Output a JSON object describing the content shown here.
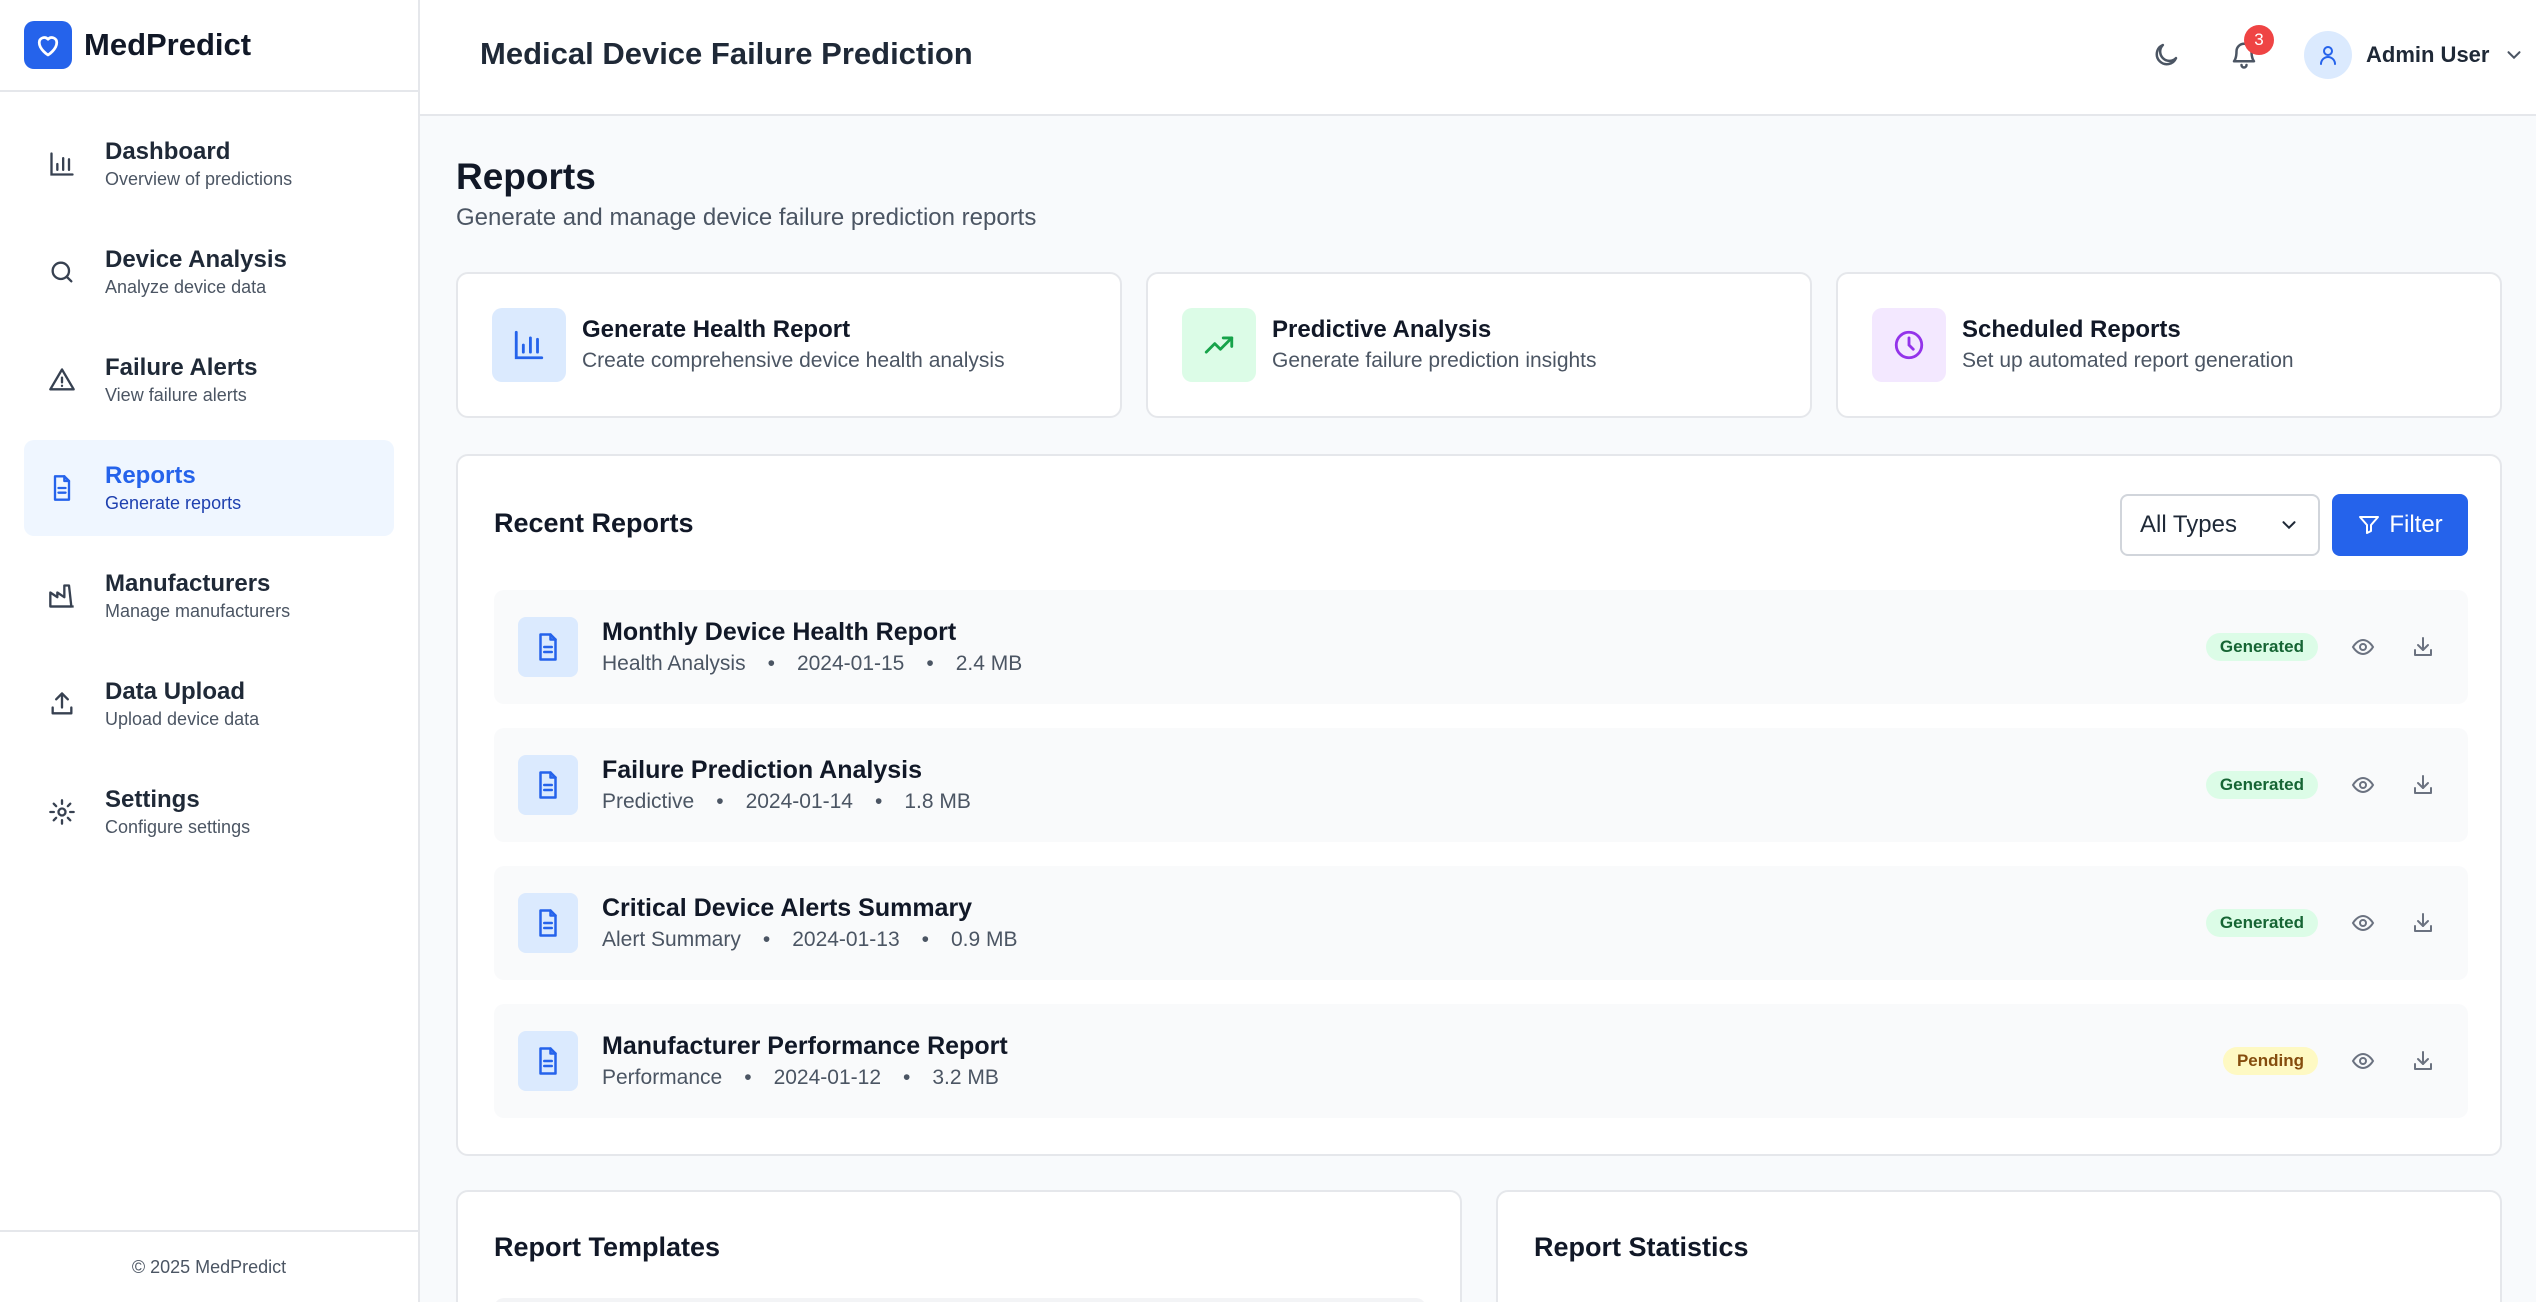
{
  "app": {
    "name": "MedPredict",
    "footer": "© 2025 MedPredict"
  },
  "sidebar": {
    "items": [
      {
        "label": "Dashboard",
        "sub": "Overview of predictions",
        "icon": "bar-chart-icon",
        "active": false
      },
      {
        "label": "Device Analysis",
        "sub": "Analyze device data",
        "icon": "search-icon",
        "active": false
      },
      {
        "label": "Failure Alerts",
        "sub": "View failure alerts",
        "icon": "alert-triangle-icon",
        "active": false
      },
      {
        "label": "Reports",
        "sub": "Generate reports",
        "icon": "file-text-icon",
        "active": true
      },
      {
        "label": "Manufacturers",
        "sub": "Manage manufacturers",
        "icon": "factory-icon",
        "active": false
      },
      {
        "label": "Data Upload",
        "sub": "Upload device data",
        "icon": "upload-icon",
        "active": false
      },
      {
        "label": "Settings",
        "sub": "Configure settings",
        "icon": "gear-icon",
        "active": false
      }
    ]
  },
  "header": {
    "title": "Medical Device Failure Prediction",
    "notification_count": "3",
    "user_name": "Admin User"
  },
  "page": {
    "title": "Reports",
    "subtitle": "Generate and manage device failure prediction reports"
  },
  "quick_actions": [
    {
      "title": "Generate Health Report",
      "sub": "Create comprehensive device health analysis",
      "icon": "bar-chart-icon",
      "color": "#2563eb",
      "bg": "#dbeafe"
    },
    {
      "title": "Predictive Analysis",
      "sub": "Generate failure prediction insights",
      "icon": "trending-up-icon",
      "color": "#16a34a",
      "bg": "#dcfce7"
    },
    {
      "title": "Scheduled Reports",
      "sub": "Set up automated report generation",
      "icon": "clock-icon",
      "color": "#9333ea",
      "bg": "#f3e8ff"
    }
  ],
  "recent_reports": {
    "title": "Recent Reports",
    "type_select": "All Types",
    "filter_label": "Filter",
    "rows": [
      {
        "title": "Monthly Device Health Report",
        "type": "Health Analysis",
        "date": "2024-01-15",
        "size": "2.4 MB",
        "status": "Generated"
      },
      {
        "title": "Failure Prediction Analysis",
        "type": "Predictive",
        "date": "2024-01-14",
        "size": "1.8 MB",
        "status": "Generated"
      },
      {
        "title": "Critical Device Alerts Summary",
        "type": "Alert Summary",
        "date": "2024-01-13",
        "size": "0.9 MB",
        "status": "Generated"
      },
      {
        "title": "Manufacturer Performance Report",
        "type": "Performance",
        "date": "2024-01-12",
        "size": "3.2 MB",
        "status": "Pending"
      }
    ]
  },
  "templates": {
    "title": "Report Templates"
  },
  "statistics": {
    "title": "Report Statistics"
  },
  "colors": {
    "accent": "#2563eb",
    "danger": "#ef4444"
  }
}
